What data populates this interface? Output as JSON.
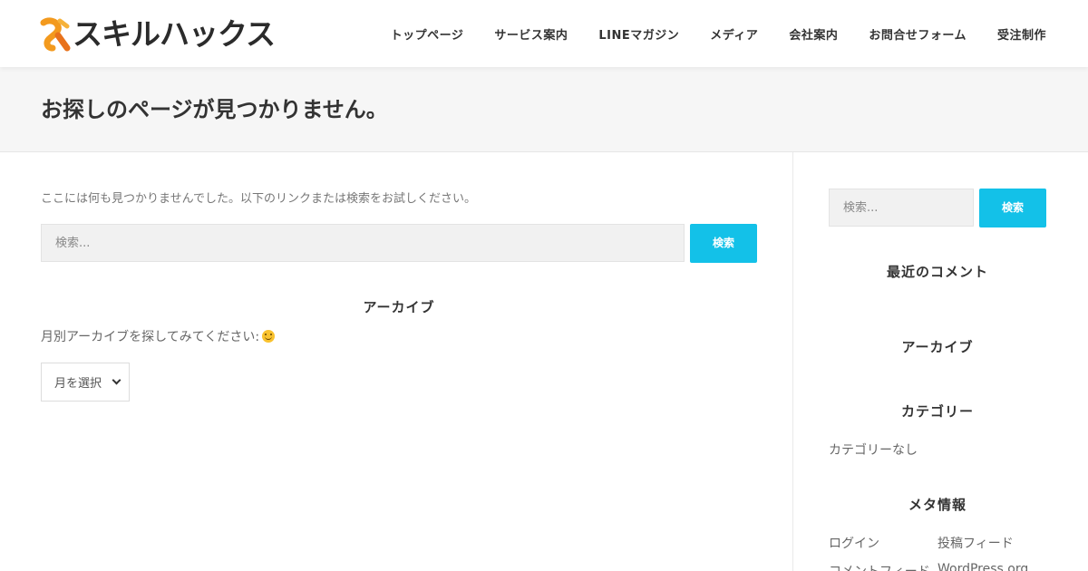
{
  "header": {
    "logo_text": "スキルハックス",
    "nav": [
      "トップページ",
      "サービス案内",
      "LINEマガジン",
      "メディア",
      "会社案内",
      "お問合せフォーム",
      "受注制作"
    ]
  },
  "page": {
    "title": "お探しのページが見つかりません。"
  },
  "main": {
    "notice": "ここには何も見つかりませんでした。以下のリンクまたは検索をお試しください。",
    "search": {
      "placeholder": "検索...",
      "button": "検索"
    },
    "archive": {
      "title": "アーカイブ",
      "text": "月別アーカイブを探してみてください:",
      "select_value": "月を選択"
    }
  },
  "sidebar": {
    "search": {
      "placeholder": "検索...",
      "button": "検索"
    },
    "recent_comments_title": "最近のコメント",
    "archive_title": "アーカイブ",
    "category_title": "カテゴリー",
    "category_none": "カテゴリーなし",
    "meta_title": "メタ情報",
    "meta_links": [
      "ログイン",
      "投稿フィード",
      "コメントフィード",
      "WordPress.org"
    ]
  },
  "colors": {
    "accent": "#13c1e8",
    "logo_orange": "#f39a1e"
  }
}
